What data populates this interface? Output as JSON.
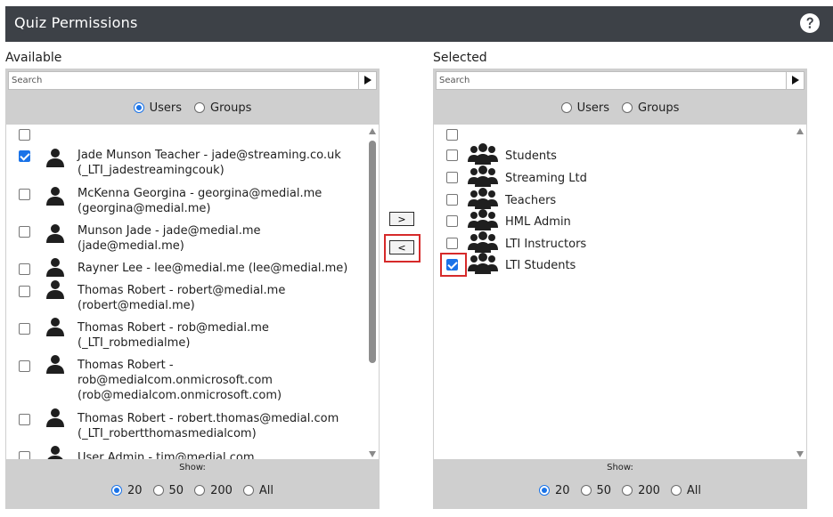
{
  "header": {
    "title": "Quiz Permissions",
    "help_icon": "question-circle-icon"
  },
  "available": {
    "label": "Available",
    "search_placeholder": "Search",
    "type_options": [
      {
        "label": "Users",
        "selected": true
      },
      {
        "label": "Groups",
        "selected": false
      }
    ],
    "items": [
      {
        "text": "",
        "checked": false,
        "icon": "none"
      },
      {
        "text": "Jade Munson Teacher - jade@streaming.co.uk (_LTI_jadestreamingcouk)",
        "checked": true,
        "icon": "user-icon"
      },
      {
        "text": "McKenna Georgina - georgina@medial.me (georgina@medial.me)",
        "checked": false,
        "icon": "user-icon"
      },
      {
        "text": "Munson Jade - jade@medial.me (jade@medial.me)",
        "checked": false,
        "icon": "user-icon"
      },
      {
        "text": "Rayner Lee - lee@medial.me (lee@medial.me)",
        "checked": false,
        "icon": "user-icon"
      },
      {
        "text": "Thomas Robert - robert@medial.me (robert@medial.me)",
        "checked": false,
        "icon": "user-icon"
      },
      {
        "text": "Thomas Robert - rob@medial.me (_LTI_robmedialme)",
        "checked": false,
        "icon": "user-icon"
      },
      {
        "text": "Thomas Robert - rob@medialcom.onmicrosoft.com (rob@medialcom.onmicrosoft.com)",
        "checked": false,
        "icon": "user-icon"
      },
      {
        "text": "Thomas Robert - robert.thomas@medial.com (_LTI_robertthomasmedialcom)",
        "checked": false,
        "icon": "user-icon"
      },
      {
        "text": "User Admin - tim@medial.com",
        "checked": false,
        "icon": "user-icon"
      }
    ],
    "show_label": "Show:",
    "page_sizes": [
      {
        "label": "20",
        "selected": true
      },
      {
        "label": "50",
        "selected": false
      },
      {
        "label": "200",
        "selected": false
      },
      {
        "label": "All",
        "selected": false
      }
    ]
  },
  "selected": {
    "label": "Selected",
    "search_placeholder": "Search",
    "type_options": [
      {
        "label": "Users",
        "selected": false
      },
      {
        "label": "Groups",
        "selected": false
      }
    ],
    "items": [
      {
        "text": "",
        "checked": false,
        "icon": "none"
      },
      {
        "text": "Students",
        "checked": false,
        "icon": "group-icon"
      },
      {
        "text": "Streaming Ltd",
        "checked": false,
        "icon": "group-icon"
      },
      {
        "text": "Teachers",
        "checked": false,
        "icon": "group-icon"
      },
      {
        "text": "HML Admin",
        "checked": false,
        "icon": "group-icon"
      },
      {
        "text": "LTI Instructors",
        "checked": false,
        "icon": "group-icon"
      },
      {
        "text": "LTI Students",
        "checked": true,
        "icon": "group-icon"
      }
    ],
    "show_label": "Show:",
    "page_sizes": [
      {
        "label": "20",
        "selected": true
      },
      {
        "label": "50",
        "selected": false
      },
      {
        "label": "200",
        "selected": false
      },
      {
        "label": "All",
        "selected": false
      }
    ]
  },
  "transfer": {
    "add_label": ">",
    "remove_label": "<"
  },
  "colors": {
    "header_bg": "#3d4147",
    "panel_gray": "#cfcfcf",
    "accent": "#1a73e8",
    "highlight": "#d62a2a"
  }
}
